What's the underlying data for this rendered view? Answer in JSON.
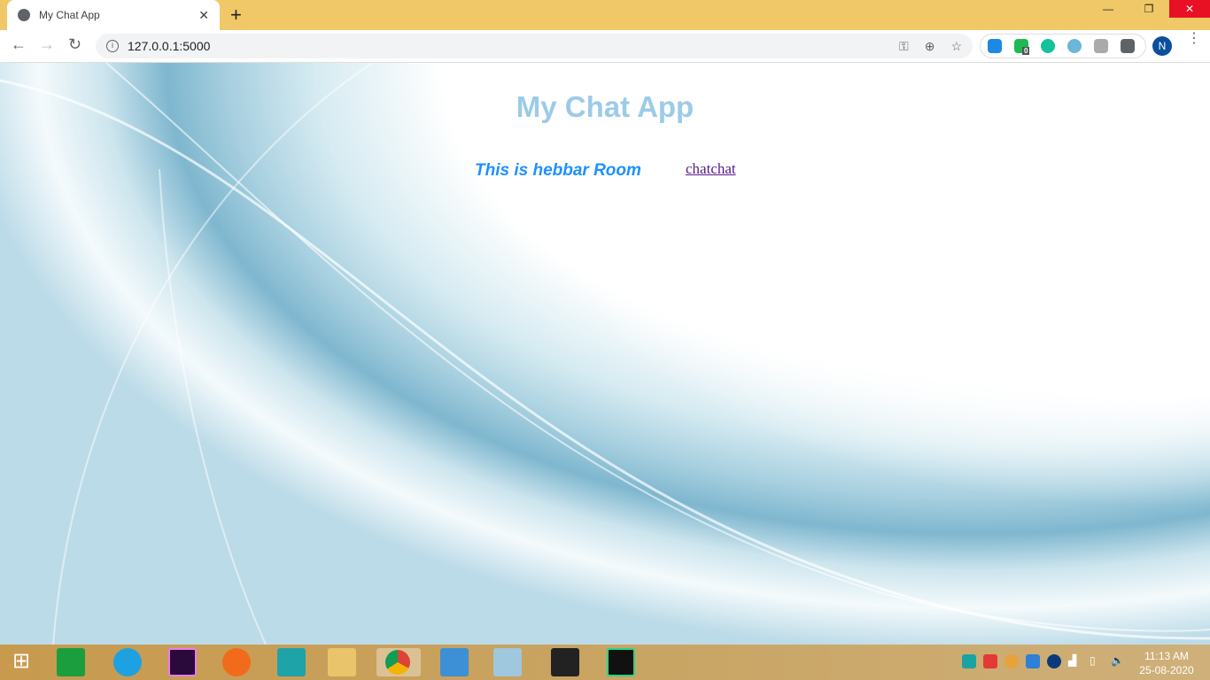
{
  "browser": {
    "tab_title": "My Chat App",
    "url": "127.0.0.1:5000",
    "profile_initial": "N",
    "extension_badge": "0"
  },
  "page": {
    "heading": "My Chat App",
    "room_label": "This is hebbar Room",
    "link_text": "chatchat"
  },
  "taskbar": {
    "time": "11:13 AM",
    "date": "25-08-2020"
  },
  "colors": {
    "heading": "#9ccbe8",
    "room": "#1e90ff",
    "link": "#551a8b",
    "tabbar": "#f0c868"
  }
}
